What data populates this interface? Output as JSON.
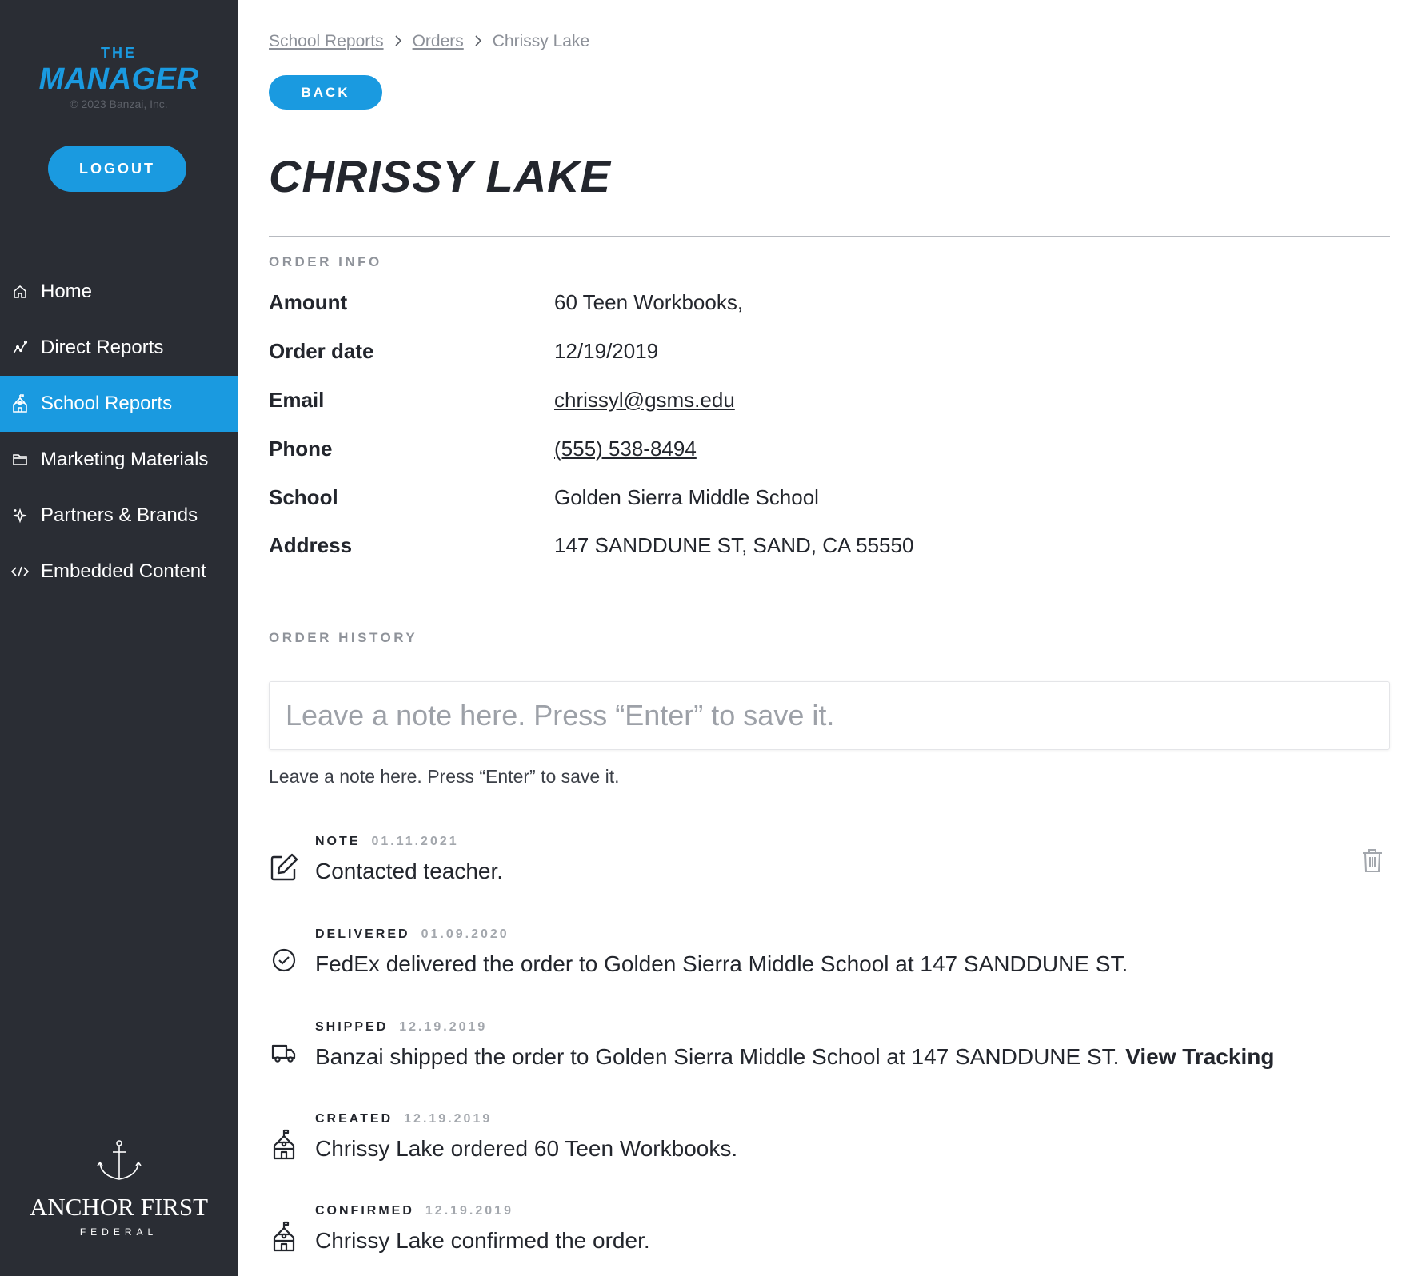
{
  "sidebar": {
    "logo_top": "THE",
    "logo_main": "MANAGER",
    "copyright": "© 2023 Banzai, Inc.",
    "logout_label": "LOGOUT",
    "items": [
      {
        "label": "Home",
        "icon": "home-icon"
      },
      {
        "label": "Direct Reports",
        "icon": "chart-line-icon"
      },
      {
        "label": "School Reports",
        "icon": "school-icon",
        "active": true
      },
      {
        "label": "Marketing Materials",
        "icon": "folder-icon"
      },
      {
        "label": "Partners & Brands",
        "icon": "sparkle-icon"
      },
      {
        "label": "Embedded Content",
        "icon": "code-icon"
      }
    ],
    "partner_name": "ANCHOR FIRST",
    "partner_sub": "FEDERAL"
  },
  "breadcrumb": {
    "items": [
      "School Reports",
      "Orders",
      "Chrissy Lake"
    ]
  },
  "back_label": "BACK",
  "page_title": "CHRISSY LAKE",
  "order_info": {
    "label": "ORDER INFO",
    "rows": [
      {
        "key": "Amount",
        "value": "60 Teen Workbooks,"
      },
      {
        "key": "Order date",
        "value": "12/19/2019"
      },
      {
        "key": "Email",
        "value": "chrissyl@gsms.edu"
      },
      {
        "key": "Phone",
        "value": "(555) 538-8494"
      },
      {
        "key": "School",
        "value": "Golden Sierra Middle School"
      },
      {
        "key": "Address",
        "value": "147 SANDDUNE ST, SAND, CA 55550"
      }
    ]
  },
  "order_history": {
    "label": "ORDER HISTORY",
    "note_placeholder": "Leave a note here. Press “Enter” to save it.",
    "hint": "Leave a note here. Press “Enter” to save it.",
    "entries": [
      {
        "type": "NOTE",
        "date": "01.11.2021",
        "message": "Contacted teacher.",
        "icon": "edit-note-icon"
      },
      {
        "type": "DELIVERED",
        "date": "01.09.2020",
        "message": "FedEx delivered the order to Golden Sierra Middle School at 147 SANDDUNE ST.",
        "icon": "check-circle-icon"
      },
      {
        "type": "SHIPPED",
        "date": "12.19.2019",
        "message": "Banzai shipped the order to Golden Sierra Middle School at 147 SANDDUNE ST.",
        "link": "View Tracking",
        "icon": "truck-icon"
      },
      {
        "type": "CREATED",
        "date": "12.19.2019",
        "message": "Chrissy Lake ordered 60 Teen Workbooks.",
        "icon": "school-icon"
      },
      {
        "type": "CONFIRMED",
        "date": "12.19.2019",
        "message": "Chrissy Lake confirmed the order.",
        "icon": "school-icon"
      }
    ]
  },
  "colors": {
    "sidebar_bg": "#2a2d34",
    "accent": "#1a9ae0",
    "text": "#23262d",
    "muted": "#8f939a"
  }
}
